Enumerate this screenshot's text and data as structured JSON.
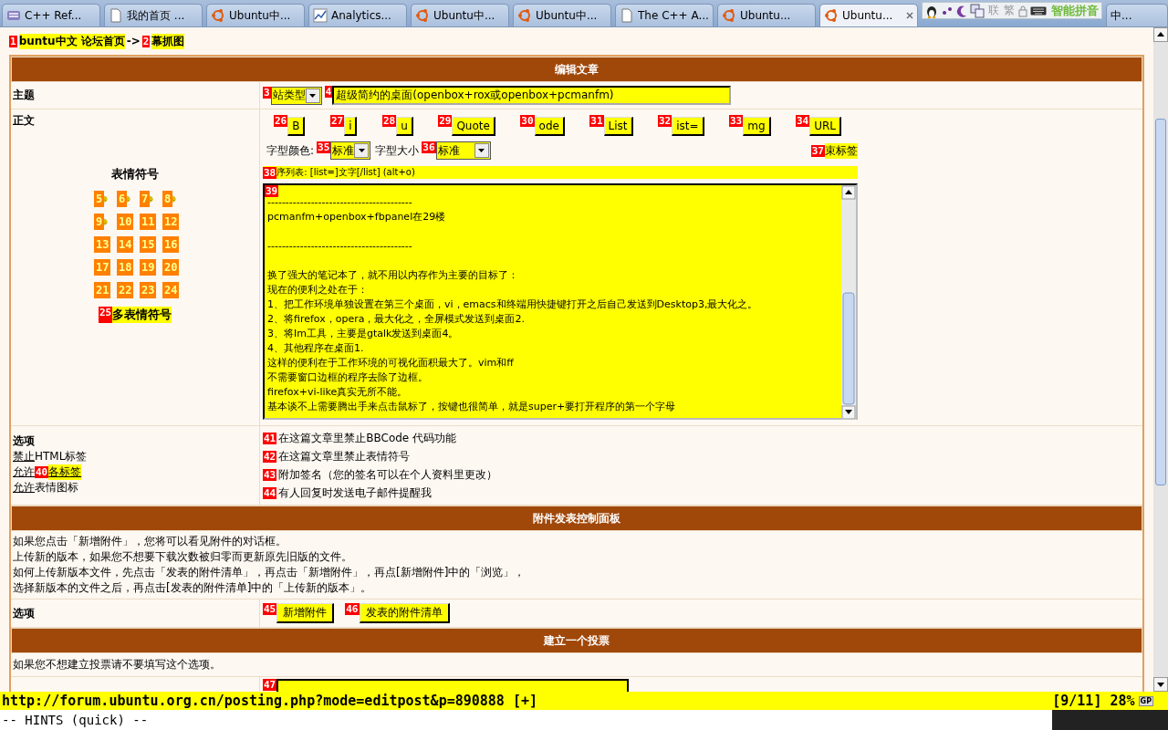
{
  "tabs": [
    {
      "title": "C++ Ref...",
      "kind": "app",
      "selected": false
    },
    {
      "title": "我的首页 ...",
      "kind": "page",
      "selected": false
    },
    {
      "title": "Ubuntu中...",
      "kind": "ubuntu",
      "selected": false
    },
    {
      "title": "Analytics...",
      "kind": "chart",
      "selected": false
    },
    {
      "title": "Ubuntu中...",
      "kind": "ubuntu",
      "selected": false
    },
    {
      "title": "Ubuntu中...",
      "kind": "ubuntu",
      "selected": false
    },
    {
      "title": "The C++ A...",
      "kind": "page",
      "selected": false
    },
    {
      "title": "Ubuntu...",
      "kind": "ubuntu",
      "selected": false
    },
    {
      "title": "Ubuntu...",
      "kind": "ubuntu",
      "selected": true
    },
    {
      "title": "中...",
      "selected": false
    }
  ],
  "ime_panel": {
    "buttons": [
      "联",
      "繁"
    ],
    "label": "智能拼音"
  },
  "breadcrumb": {
    "links": [
      {
        "hint": "1",
        "text": "buntu中文 论坛首页"
      },
      {
        "hint": "2",
        "text": "幕抓图"
      }
    ],
    "separator": "->"
  },
  "form": {
    "title": "编辑文章",
    "subject": {
      "label": "主题",
      "type_select": {
        "hint": "3",
        "value": "站类型"
      },
      "input": {
        "hint": "4",
        "value": "超级简约的桌面(openbox+rox或openbox+pcmanfm)"
      }
    },
    "body": {
      "label": "正文",
      "smilies_title": "表情符号",
      "smilies": [
        {
          "hint": "5",
          "face": true
        },
        {
          "hint": "6",
          "face": true
        },
        {
          "hint": "7",
          "face": true
        },
        {
          "hint": "8",
          "face": true
        },
        {
          "hint": "9",
          "face": true
        },
        {
          "hint": "10"
        },
        {
          "hint": "11"
        },
        {
          "hint": "12"
        },
        {
          "hint": "13"
        },
        {
          "hint": "14"
        },
        {
          "hint": "15"
        },
        {
          "hint": "16"
        },
        {
          "hint": "17"
        },
        {
          "hint": "18"
        },
        {
          "hint": "19"
        },
        {
          "hint": "20"
        },
        {
          "hint": "21"
        },
        {
          "hint": "22"
        },
        {
          "hint": "23"
        },
        {
          "hint": "24"
        }
      ],
      "more_smilies": {
        "hint": "25",
        "text": "多表情符号"
      },
      "format_buttons": [
        {
          "hint": "26",
          "label": "B"
        },
        {
          "hint": "27",
          "label": "i"
        },
        {
          "hint": "28",
          "label": "u"
        },
        {
          "hint": "29",
          "label": "Quote"
        },
        {
          "hint": "30",
          "label": "ode"
        },
        {
          "hint": "31",
          "label": "List"
        },
        {
          "hint": "32",
          "label": "ist="
        },
        {
          "hint": "33",
          "label": "mg"
        },
        {
          "hint": "34",
          "label": "URL"
        }
      ],
      "font_color": {
        "label": "字型颜色:",
        "hint": "35",
        "value": "标准"
      },
      "font_size": {
        "label": "字型大小",
        "hint": "36",
        "value": "标准"
      },
      "close_tags": {
        "hint": "37",
        "text": "束标签"
      },
      "help_line": {
        "hint": "38",
        "text": "序列表: [list=]文字[/list]  (alt+o)"
      },
      "textarea": {
        "hint": "39",
        "blocks": [
          [
            "----------------------------------------",
            "pcmanfm+openbox+fbpanel在29楼"
          ],
          [
            "----------------------------------------"
          ],
          [
            "换了强大的笔记本了，就不用以内存作为主要的目标了：",
            "现在的便利之处在于：",
            "1、把工作环境单独设置在第三个桌面，vi，emacs和终端用快捷键打开之后自己发送到Desktop3,最大化之。",
            "2、将firefox，opera，最大化之，全屏模式发送到桌面2.",
            "3、将Im工具，主要是gtalk发送到桌面4。",
            "4、其他程序在桌面1.",
            "这样的便利在于工作环境的可视化面积最大了。vim和ff",
            "不需要窗口边框的程序去除了边框。",
            "firefox+vi-like真实无所不能。",
            "基本谈不上需要腾出手来点击鼠标了，按键也很简单，就是super+要打开程序的第一个字母"
          ]
        ]
      }
    },
    "options": {
      "label": "选项",
      "notes": [
        {
          "link": "禁止",
          "text": "HTML标签"
        },
        {
          "link": "允许",
          "hint": "40",
          "text": "各标签"
        },
        {
          "link": "允许",
          "text": "表情图标"
        }
      ],
      "checkboxes": [
        {
          "hint": "41",
          "label": "在这篇文章里禁止BBCode 代码功能"
        },
        {
          "hint": "42",
          "label": "在这篇文章里禁止表情符号"
        },
        {
          "hint": "43",
          "label": "附加签名（您的签名可以在个人资料里更改）"
        },
        {
          "hint": "44",
          "label": "有人回复时发送电子邮件提醒我"
        }
      ]
    }
  },
  "attachments": {
    "title": "附件发表控制面板",
    "lines": [
      "如果您点击「新增附件」，您将可以看见附件的对话框。",
      "上传新的版本，如果您不想要下载次数被归零而更新原先旧版的文件。",
      "如何上传新版本文件，先点击「发表的附件清单」，再点击「新增附件」，再点[新增附件]中的「浏览」，",
      "选择新版本的文件之后，再点击[发表的附件清单]中的「上传新的版本」。"
    ],
    "options_label": "选项",
    "buttons": [
      {
        "hint": "45",
        "label": "新增附件"
      },
      {
        "hint": "46",
        "label": "发表的附件清单"
      }
    ]
  },
  "poll": {
    "title": "建立一个投票",
    "note": "如果您不想建立投票请不要填写这个选项。",
    "question_input": {
      "hint": "47"
    }
  },
  "status_bar": {
    "url": "http://forum.ubuntu.org.cn/posting.php?mode=editpost&p=890888 [+]",
    "position": "[9/11] 28%",
    "badge": "GP"
  },
  "command_line": "-- HINTS (quick) --"
}
